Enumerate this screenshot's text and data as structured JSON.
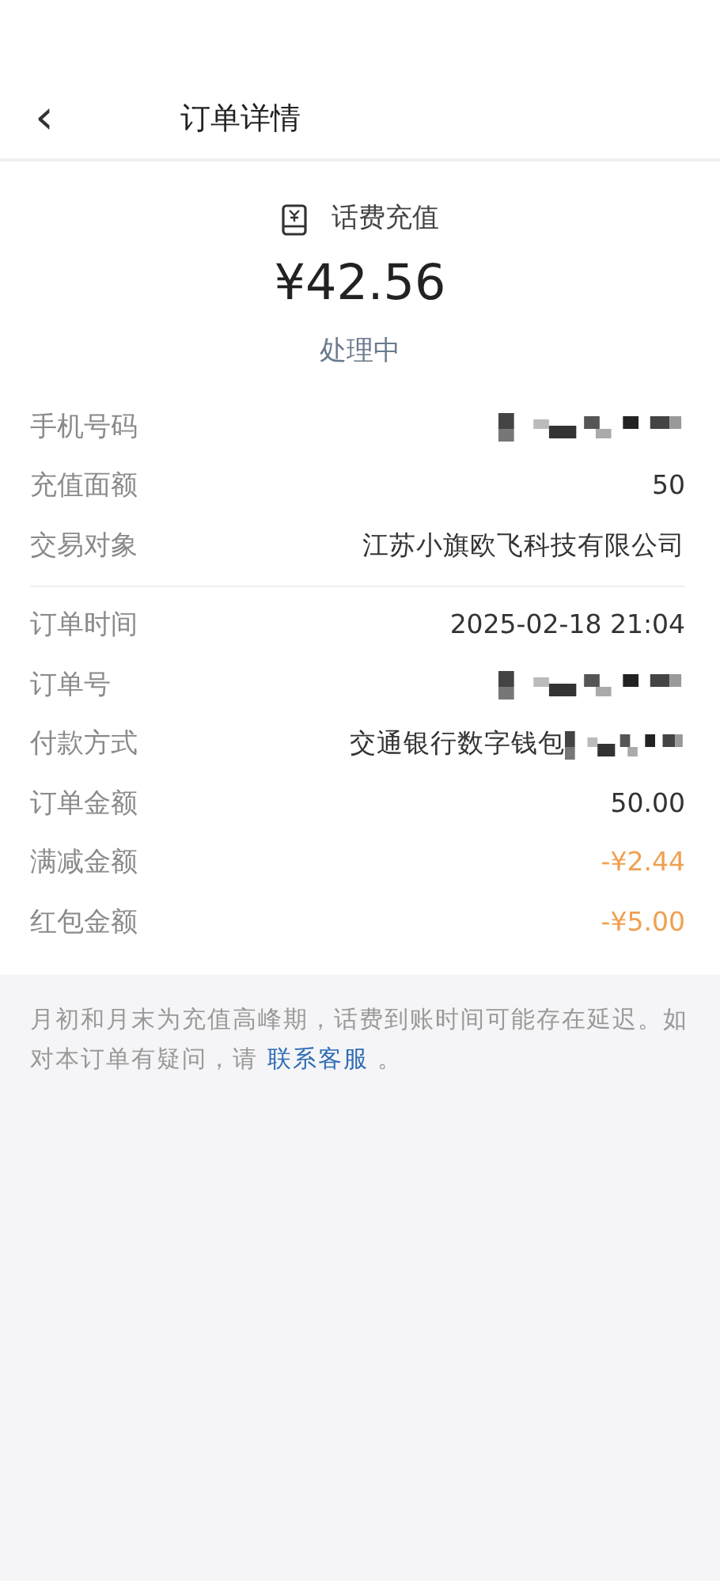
{
  "header": {
    "back": "‹",
    "title": "订单详情"
  },
  "summary": {
    "category": "话费充值",
    "amount": "¥42.56",
    "status": "处理中"
  },
  "groups": [
    {
      "rows": [
        {
          "label": "手机号码",
          "kind": "redacted"
        },
        {
          "label": "充值面额",
          "kind": "text",
          "value": "50",
          "highlighted": false
        },
        {
          "label": "交易对象",
          "kind": "text",
          "value": "江苏小旗欧飞科技有限公司",
          "highlighted": false
        }
      ]
    },
    {
      "rows": [
        {
          "label": "订单时间",
          "kind": "text",
          "value": "2025-02-18 21:04",
          "highlighted": false
        },
        {
          "label": "订单号",
          "kind": "redacted"
        },
        {
          "label": "付款方式",
          "kind": "partly_redacted",
          "value": "交通银行数字钱包",
          "highlighted": false
        },
        {
          "label": "订单金额",
          "kind": "text",
          "value": "50.00",
          "highlighted": false
        },
        {
          "label": "满减金额",
          "kind": "text",
          "value": "-¥2.44",
          "highlighted": true
        },
        {
          "label": "红包金额",
          "kind": "text",
          "value": "-¥5.00",
          "highlighted": true
        }
      ]
    }
  ],
  "notice": {
    "text": "月初和月末为充值高峰期，话费到账时间可能存在延迟。如对本订单有疑问，请 ",
    "link": "联系客服",
    "after": " 。"
  }
}
